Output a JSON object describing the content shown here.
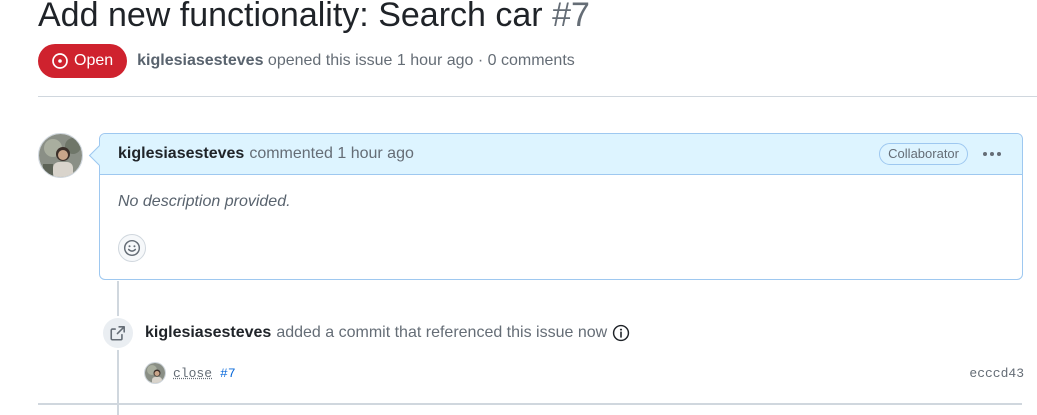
{
  "issue": {
    "title": "Add new functionality: Search car",
    "number": "#7",
    "state": "Open",
    "author": "kiglesiasesteves",
    "opened_text": "opened this issue 1 hour ago · 0 comments"
  },
  "comment": {
    "author": "kiglesiasesteves",
    "action": "commented 1 hour ago",
    "role": "Collaborator",
    "body": "No description provided."
  },
  "event": {
    "author": "kiglesiasesteves",
    "text": "added a commit that referenced this issue now",
    "commit": {
      "message": "close",
      "reference": "#7",
      "sha": "ecccd43"
    }
  },
  "colors": {
    "open_badge": "#cf222e",
    "comment_header": "#ddf4ff",
    "link": "#0969da"
  },
  "icons": {
    "state": "issue-opened-icon",
    "menu": "kebab-horizontal-icon",
    "reaction": "smiley-icon",
    "event": "cross-reference-icon",
    "info": "info-icon"
  }
}
